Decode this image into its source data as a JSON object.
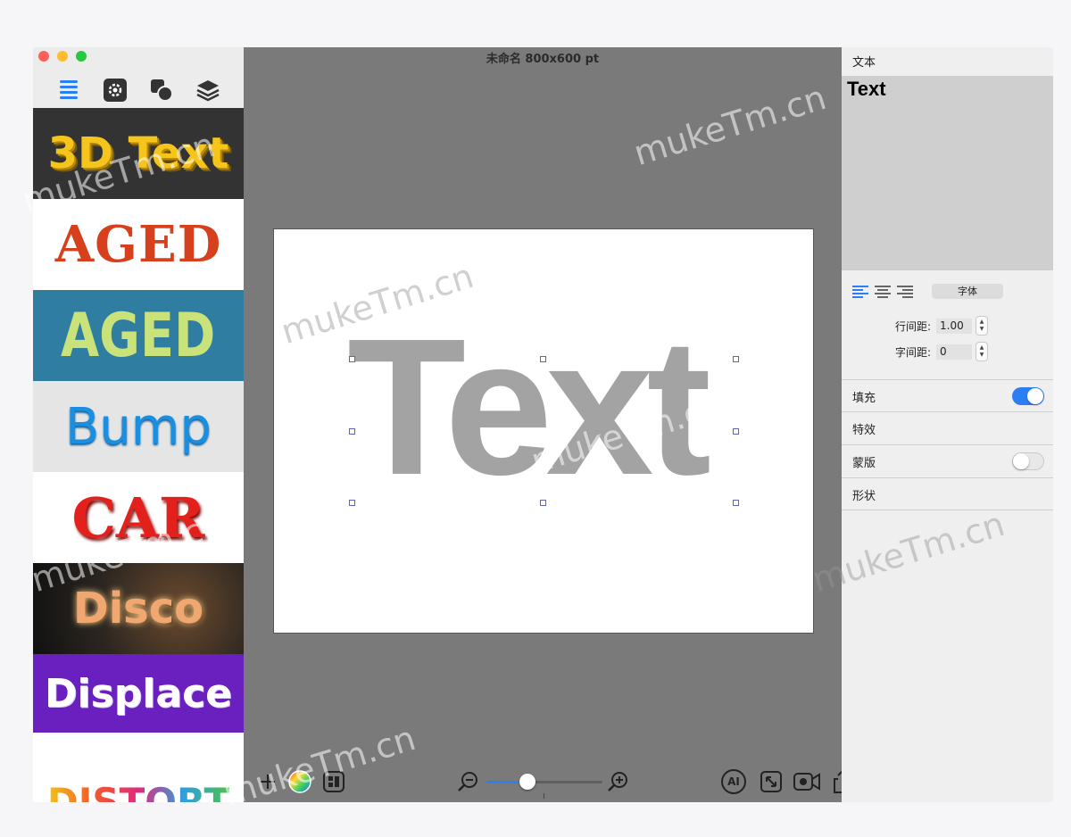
{
  "window": {
    "document_title": "未命名 800x600 pt"
  },
  "sidebar": {
    "tools": [
      {
        "name": "list-icon"
      },
      {
        "name": "gear-icon"
      },
      {
        "name": "shapes-icon"
      },
      {
        "name": "layers-icon"
      }
    ],
    "styles": [
      {
        "label": "3D Text"
      },
      {
        "label": "AGED"
      },
      {
        "label": "AGED"
      },
      {
        "label": "Bump"
      },
      {
        "label": "CAR"
      },
      {
        "label": "Disco"
      },
      {
        "label": "Displace"
      },
      {
        "label": "DISTORT"
      }
    ]
  },
  "canvas": {
    "text": "Text",
    "text_color": "#a3a3a3",
    "zoom_fraction": 0.35
  },
  "bottom_toolbar": {
    "ai_label": "AI"
  },
  "inspector": {
    "title": "文本",
    "preview_text": "Text",
    "font_button": "字体",
    "line_spacing_label": "行间距:",
    "line_spacing_value": "1.00",
    "char_spacing_label": "字间距:",
    "char_spacing_value": "0",
    "sections": {
      "fill": {
        "label": "填充",
        "enabled": true
      },
      "effects": {
        "label": "特效"
      },
      "mask": {
        "label": "蒙版",
        "enabled": false
      },
      "shape": {
        "label": "形状"
      }
    }
  },
  "watermark": "mukeTm.cn",
  "colors": {
    "accent": "#2c7ff3",
    "canvas_bg": "#7a7a7a"
  }
}
